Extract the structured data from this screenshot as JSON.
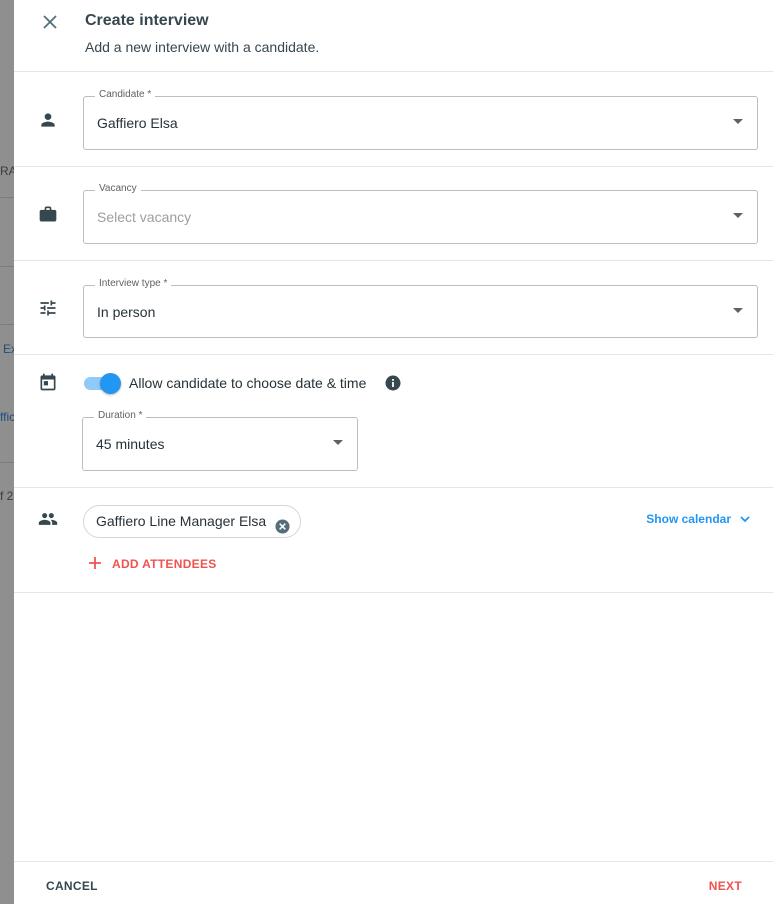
{
  "background": {
    "fragments": [
      "RA",
      "Ex",
      "ffic",
      "f 2"
    ]
  },
  "header": {
    "title": "Create interview",
    "subtitle": "Add a new interview with a candidate."
  },
  "candidate": {
    "label": "Candidate *",
    "value": "Gaffiero Elsa"
  },
  "vacancy": {
    "label": "Vacancy",
    "placeholder": "Select vacancy"
  },
  "interview_type": {
    "label": "Interview type *",
    "value": "In person"
  },
  "scheduling": {
    "toggle_label": "Allow candidate to choose date & time",
    "toggle_on": true,
    "duration_label": "Duration *",
    "duration_value": "45 minutes"
  },
  "attendees": {
    "chips": [
      "Gaffiero Line Manager Elsa"
    ],
    "show_calendar": "Show calendar",
    "add_label": "ADD ATTENDEES"
  },
  "footer": {
    "cancel_label": "CANCEL",
    "next_label": "NEXT"
  },
  "colors": {
    "accent_blue": "#2196f3",
    "accent_red": "#ef5350",
    "text_dark": "#37474f"
  }
}
